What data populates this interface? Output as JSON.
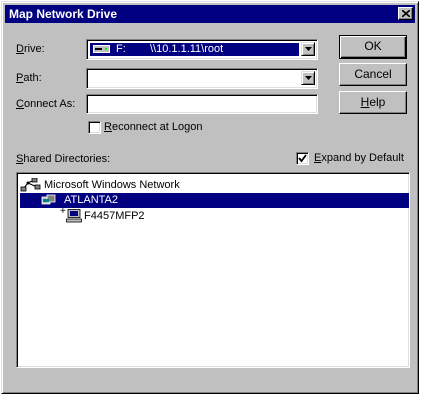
{
  "window": {
    "title": "Map Network Drive"
  },
  "drive": {
    "label": "Drive:",
    "letter": "F:",
    "path": "\\\\10.1.1.11\\root"
  },
  "path": {
    "label": "Path:",
    "value": ""
  },
  "connect_as": {
    "label": "Connect As:",
    "value": ""
  },
  "reconnect": {
    "label": "Reconnect at Logon",
    "checked": false
  },
  "expand": {
    "label": "Expand by Default",
    "checked": true
  },
  "shared": {
    "label": "Shared Directories:"
  },
  "buttons": {
    "ok": "OK",
    "cancel": "Cancel",
    "help": "Help"
  },
  "tree": {
    "root": "Microsoft Windows Network",
    "items": [
      {
        "label": "ATLANTA2",
        "selected": true,
        "icon": "workgroup-icon"
      },
      {
        "label": "F4457MFP2",
        "selected": false,
        "icon": "server-icon"
      }
    ]
  },
  "colors": {
    "selection": "#000080",
    "titlebar": "#000080",
    "face": "#c0c0c0"
  }
}
